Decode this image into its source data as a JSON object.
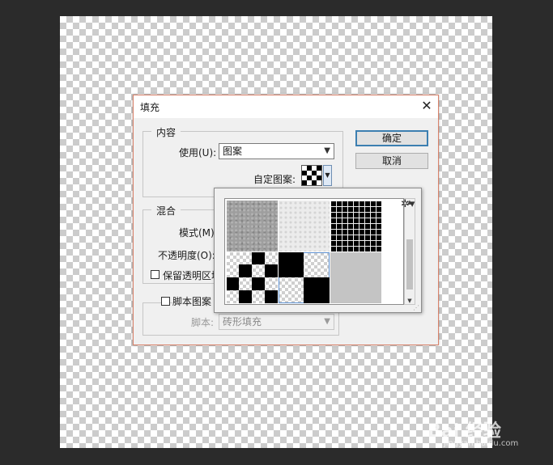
{
  "dialog": {
    "title": "填充",
    "close_glyph": "✕",
    "ok_label": "确定",
    "cancel_label": "取消"
  },
  "content_group": {
    "title": "内容",
    "use_label": "使用(U):",
    "use_value": "图案",
    "custom_pattern_label": "自定图案:"
  },
  "blend_group": {
    "title": "混合",
    "mode_label": "模式(M):",
    "opacity_label": "不透明度(O):",
    "preserve_label": "保留透明区域(P)"
  },
  "script_group": {
    "title": "脚本图案",
    "script_label": "脚本:",
    "script_value": "砖形填充"
  },
  "picker": {
    "patterns": [
      {
        "name": "pattern-gray-noise"
      },
      {
        "name": "pattern-white-texture"
      },
      {
        "name": "pattern-black-grid"
      },
      {
        "name": "pattern-checker-large"
      },
      {
        "name": "pattern-checker-black"
      },
      {
        "name": "pattern-solid-gray"
      }
    ],
    "selected_index": 4,
    "gear_icon": "gear-icon",
    "scroll_up": "▲",
    "scroll_down": "▼"
  },
  "watermark": {
    "text": "Bai 经验",
    "url": "jingyan.baidu.com"
  },
  "colors": {
    "workspace_bg": "#2b2b2b",
    "dialog_bg": "#f0f0f0",
    "dialog_border": "#d9826a",
    "primary_button_border": "#3c7fb1"
  }
}
